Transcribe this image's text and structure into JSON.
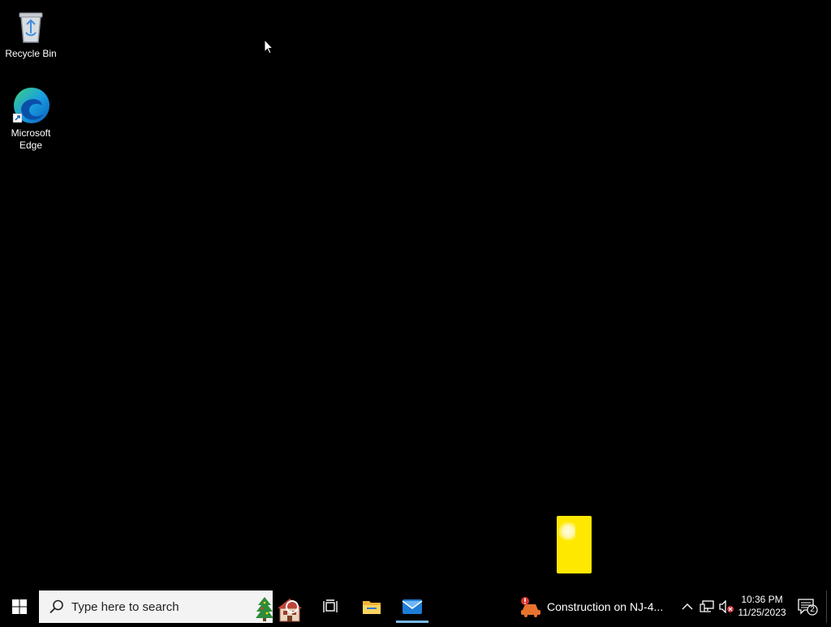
{
  "desktop": {
    "icons": [
      {
        "label": "Recycle Bin",
        "icon": "recycle-bin-icon"
      },
      {
        "label": "Microsoft Edge",
        "icon": "edge-icon"
      }
    ]
  },
  "taskbar": {
    "search_placeholder": "Type here to search",
    "pinned": [
      "cortana-icon",
      "task-view-icon",
      "file-explorer-icon",
      "mail-icon"
    ],
    "news": {
      "text": "Construction on NJ-4..."
    },
    "clock": {
      "time": "10:36 PM",
      "date": "11/25/2023"
    },
    "notifications_count": "2"
  },
  "colors": {
    "desktop": "#000000",
    "accent": "#76b9ed",
    "yellow_window": "#ffe800"
  }
}
